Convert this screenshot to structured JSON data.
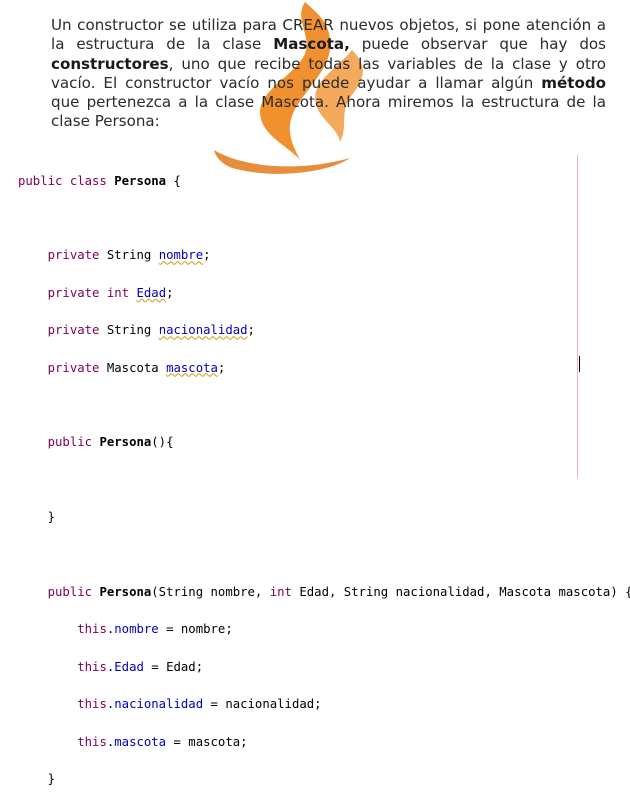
{
  "paragraph": {
    "p1": "Un constructor se utiliza para CREAR nuevos objetos, si pone atención a la estructura de la clase ",
    "b1": "Mascota,",
    "p2": " puede observar que hay dos ",
    "b2": "constructores",
    "p3": ", uno que recibe todas las variables de la clase y otro vacío.  El constructor vacío nos puede ayudar a llamar algún ",
    "b3": "método",
    "p4": " que pertenezca a la clase Mascota. Ahora miremos la estructura de la clase Persona:"
  },
  "code": {
    "l1": {
      "kw": "public class ",
      "name": "Persona",
      "rest": " {"
    },
    "fields": [
      {
        "mod": "private",
        "type": " String ",
        "name": "nombre",
        "end": ";"
      },
      {
        "mod": "private",
        "type": " int ",
        "name": "Edad",
        "end": ";"
      },
      {
        "mod": "private",
        "type": " String ",
        "name": "nacionalidad",
        "end": ";"
      },
      {
        "mod": "private",
        "type": " Mascota ",
        "name": "mascota",
        "end": ";"
      }
    ],
    "ctor1": {
      "kw": "public ",
      "name": "Persona",
      "rest": "(){"
    },
    "ctor1_close": "}",
    "ctor2": {
      "kw": "public ",
      "name": "Persona",
      "p1": "(String nombre, ",
      "int": "int",
      "p2": " Edad, String nacionalidad, Mascota mascota) {"
    },
    "assigns": [
      {
        "this": "this",
        "dot": ".",
        "field": "nombre",
        "rest": " = nombre;"
      },
      {
        "this": "this",
        "dot": ".",
        "field": "Edad",
        "rest": " = Edad;"
      },
      {
        "this": "this",
        "dot": ".",
        "field": "nacionalidad",
        "rest": " = nacionalidad;"
      },
      {
        "this": "this",
        "dot": ".",
        "field": "mascota",
        "rest": " = mascota;"
      }
    ],
    "ctor2_close": "}"
  }
}
